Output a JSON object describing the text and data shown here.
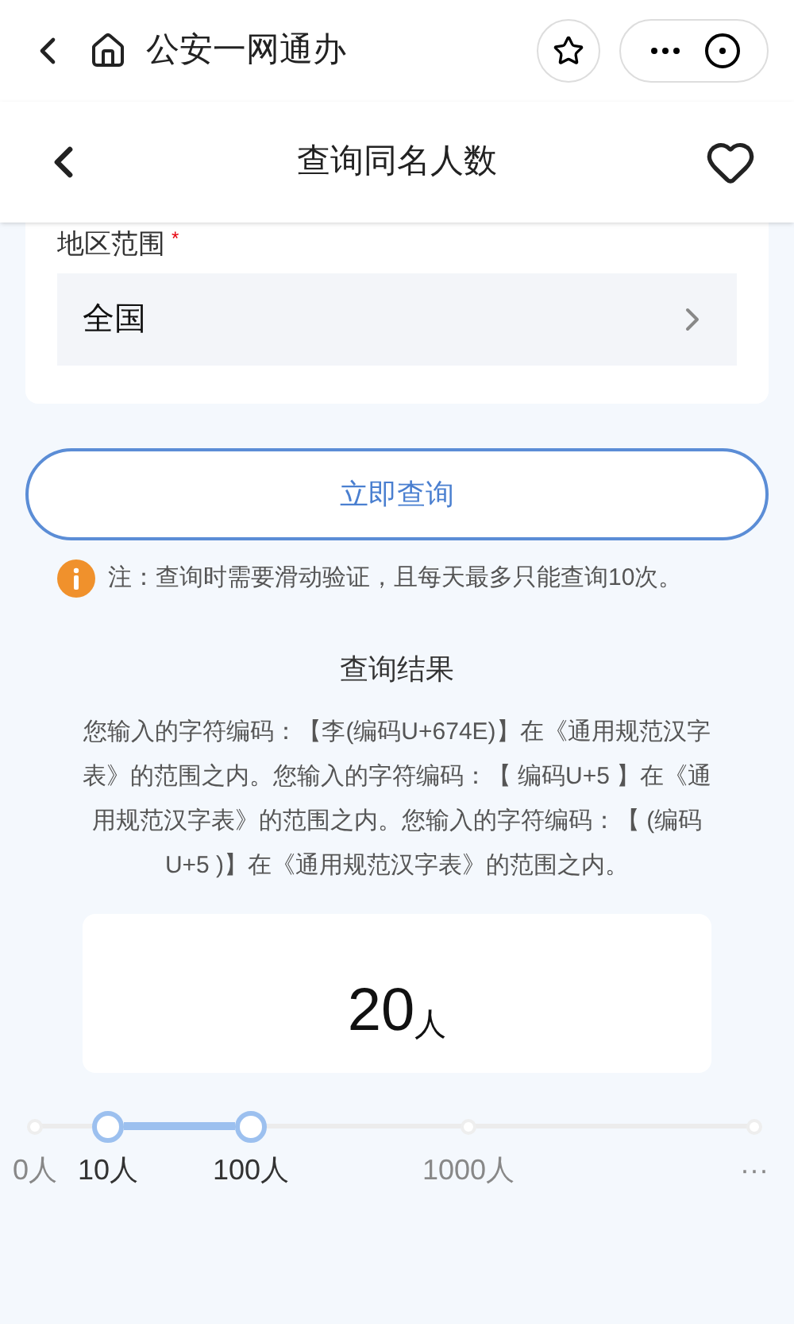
{
  "app_bar": {
    "title": "公安一网通办"
  },
  "header": {
    "title": "查询同名人数"
  },
  "form": {
    "label": "地区范围",
    "required_mark": "*",
    "region": "全国"
  },
  "query_button": "立即查询",
  "note": "注：查询时需要滑动验证，且每天最多只能查询10次。",
  "result": {
    "title": "查询结果",
    "message": "您输入的字符编码：【李(编码U+674E)】在《通用规范汉字表》的范围之内。您输入的字符编码：【 编码U+5 】在《通用规范汉字表》的范围之内。您输入的字符编码：【 (编码U+5 )】在《通用规范汉字表》的范围之内。",
    "count": "20",
    "unit": "人"
  },
  "scale": [
    {
      "label": "0人",
      "selected": false
    },
    {
      "label": "10人",
      "selected": true
    },
    {
      "label": "100人",
      "selected": true
    },
    {
      "label": "1000人",
      "selected": false
    },
    {
      "label": "···",
      "selected": false
    }
  ]
}
